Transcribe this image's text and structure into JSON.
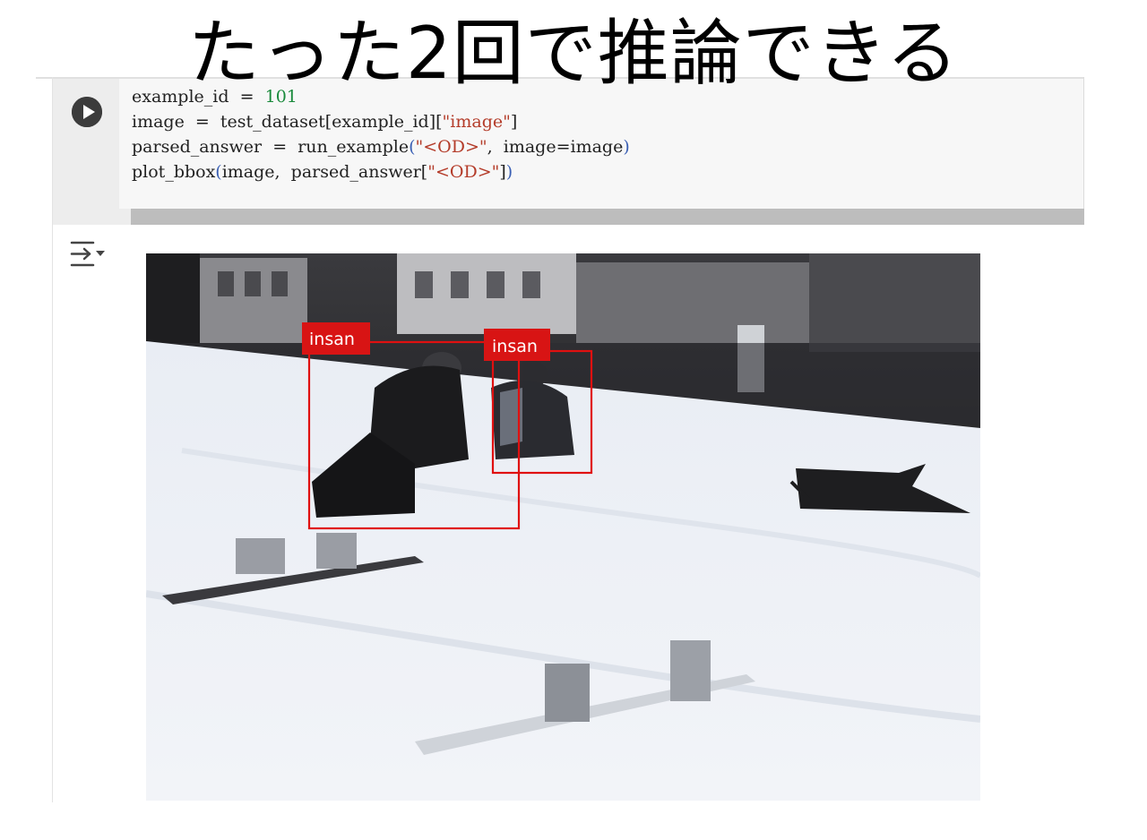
{
  "slide": {
    "title": "たった2回で推論できる"
  },
  "notebook": {
    "cell": {
      "code_lines": [
        [
          {
            "t": "example_id",
            "c": "name"
          },
          {
            "t": "  =  ",
            "c": "name"
          },
          {
            "t": "101",
            "c": "num"
          }
        ],
        [
          {
            "t": "image",
            "c": "name"
          },
          {
            "t": "  =  ",
            "c": "name"
          },
          {
            "t": "test_dataset[example_id][",
            "c": "name"
          },
          {
            "t": "\"image\"",
            "c": "str"
          },
          {
            "t": "]",
            "c": "name"
          }
        ],
        [
          {
            "t": "parsed_answer",
            "c": "name"
          },
          {
            "t": "  =  ",
            "c": "name"
          },
          {
            "t": "run_example",
            "c": "name"
          },
          {
            "t": "(",
            "c": "paren"
          },
          {
            "t": "\"<OD>\"",
            "c": "str"
          },
          {
            "t": ",  image=image",
            "c": "name"
          },
          {
            "t": ")",
            "c": "paren"
          }
        ],
        [
          {
            "t": "plot_bbox",
            "c": "name"
          },
          {
            "t": "(",
            "c": "paren"
          },
          {
            "t": "image,  parsed_answer[",
            "c": "name"
          },
          {
            "t": "\"<OD>\"",
            "c": "str"
          },
          {
            "t": "]",
            "c": "name"
          },
          {
            "t": ")",
            "c": "paren"
          }
        ]
      ],
      "run_icon": "play-circle-icon",
      "output_toggle_icon": "output-collapse-icon"
    },
    "output": {
      "detections": [
        {
          "label": "insan"
        },
        {
          "label": "insan"
        }
      ]
    }
  },
  "colors": {
    "bbox": "#e01010",
    "label_bg": "#d81414",
    "code_bg": "#f7f7f7",
    "gutter_bg": "#ededed",
    "run_button": "#3c3c3c"
  }
}
